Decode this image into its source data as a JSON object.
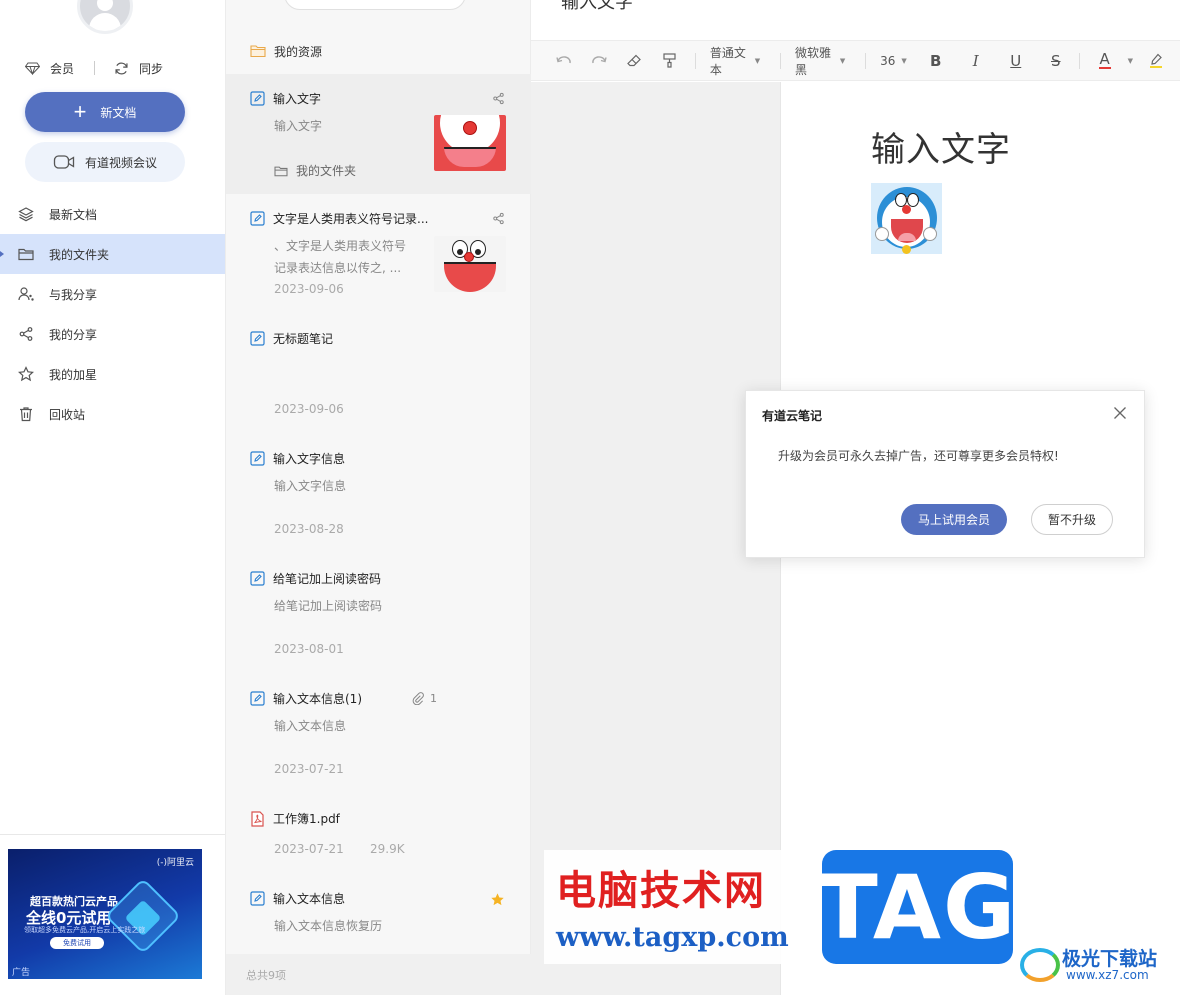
{
  "sidebar": {
    "member_label": "会员",
    "sync_label": "同步",
    "new_doc_label": "新文档",
    "video_meeting_label": "有道视频会议",
    "nav": [
      {
        "label": "最新文档",
        "icon": "layers-icon"
      },
      {
        "label": "我的文件夹",
        "icon": "folder-icon",
        "active": true
      },
      {
        "label": "与我分享",
        "icon": "shared-users-icon"
      },
      {
        "label": "我的分享",
        "icon": "share-icon"
      },
      {
        "label": "我的加星",
        "icon": "star-icon"
      },
      {
        "label": "回收站",
        "icon": "trash-icon"
      }
    ],
    "ad": {
      "brand": "(-)阿里云",
      "line1": "超百款热门云产品",
      "line2": "全线0元试用",
      "line3": "领取超多免费云产品,开启云上实践之旅",
      "button": "免费试用",
      "label": "广告"
    }
  },
  "list": {
    "resources_label": "我的资源",
    "notes": [
      {
        "title": "输入文字",
        "snippet": "输入文字",
        "folder": "我的文件夹",
        "right_icon": "share-icon"
      },
      {
        "title": "文字是人类用表义符号记录...",
        "snippet": "、文字是人类用表义符号记录表达信息以传之, ...",
        "date": "2023-09-06",
        "right_icon": "share-icon"
      },
      {
        "title": "无标题笔记",
        "date": "2023-09-06"
      },
      {
        "title": "输入文字信息",
        "snippet": "输入文字信息",
        "date": "2023-08-28"
      },
      {
        "title": "给笔记加上阅读密码",
        "snippet": "给笔记加上阅读密码",
        "date": "2023-08-01"
      },
      {
        "title": "输入文本信息(1)",
        "snippet": "输入文本信息",
        "date": "2023-07-21",
        "attachments": "1"
      },
      {
        "title": "工作簿1.pdf",
        "date": "2023-07-21",
        "size": "29.9K"
      },
      {
        "title": "输入文本信息",
        "snippet": "输入文本信息恢复历",
        "right_icon": "star-filled-icon"
      }
    ],
    "footer": "总共9项"
  },
  "editor": {
    "top_title": "输入文字",
    "toolbar": {
      "paragraph_style": "普通文本",
      "font_family": "微软雅黑",
      "font_size": "36",
      "bold": "B",
      "italic": "I",
      "underline": "U",
      "strike": "S",
      "font_color": "A"
    },
    "doc_title": "输入文字"
  },
  "dialog": {
    "title": "有道云笔记",
    "message": "升级为会员可永久去掉广告，还可尊享更多会员特权!",
    "primary": "马上试用会员",
    "secondary": "暂不升级"
  },
  "watermark": {
    "cn": "电脑技术网",
    "url": "www.tagxp.com",
    "tag": "TAG",
    "jg_cn": "极光下载站",
    "jg_url": "www.xz7.com"
  },
  "colors": {
    "accent": "#5470c0",
    "active_nav_bg": "#d6e3fb",
    "list_bg": "#f7f7f7",
    "editor_gray": "#f0f0f0"
  }
}
